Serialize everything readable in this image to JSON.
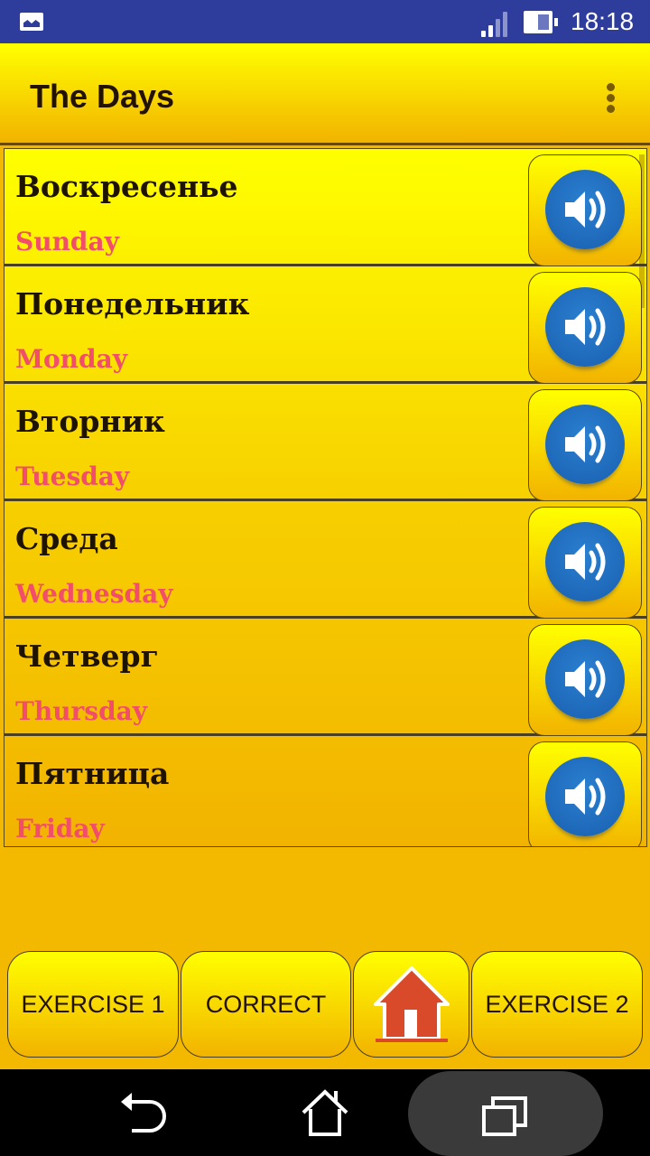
{
  "status_bar": {
    "time": "18:18",
    "notification_icon": "gallery-icon",
    "signal_icon": "signal-icon",
    "battery_icon": "battery-icon"
  },
  "app_bar": {
    "title": "The Days",
    "menu_icon": "overflow-menu-icon"
  },
  "days": [
    {
      "russian": "Воскресенье",
      "english": "Sunday"
    },
    {
      "russian": "Понедельник",
      "english": "Monday"
    },
    {
      "russian": "Вторник",
      "english": "Tuesday"
    },
    {
      "russian": "Среда",
      "english": "Wednesday"
    },
    {
      "russian": "Четверг",
      "english": "Thursday"
    },
    {
      "russian": "Пятница",
      "english": "Friday"
    }
  ],
  "bottom_buttons": {
    "exercise1": "EXERCISE 1",
    "correct": "CORRECT",
    "home_icon": "home-icon",
    "exercise2": "EXERCISE 2"
  },
  "nav_bar": {
    "back": "back-icon",
    "home": "home-icon",
    "recents": "recents-icon"
  },
  "colors": {
    "status_bar": "#2e3d9b",
    "accent_yellow": "#ffff00",
    "accent_orange": "#f2b300",
    "english_text": "#f24d6a",
    "sound_blue": "#1a6fc0"
  }
}
